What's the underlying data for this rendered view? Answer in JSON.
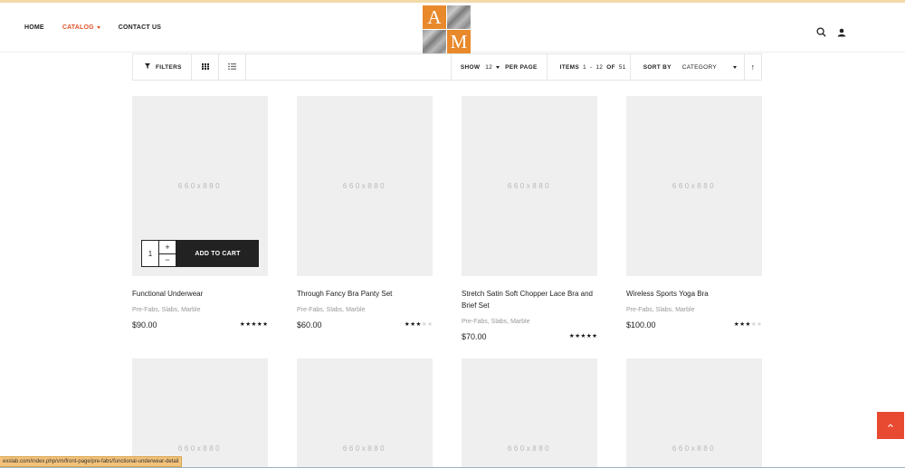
{
  "nav": {
    "home": "HOME",
    "catalog": "CATALOG",
    "contact": "CONTACT US"
  },
  "logo": {
    "letter_a": "A",
    "letter_m": "M"
  },
  "toolbar": {
    "filters_label": "FILTERS",
    "show_label": "SHOW",
    "show_value": "12",
    "per_page_label": "PER PAGE",
    "items_label": "ITEMS",
    "items_from": "1",
    "items_dash": "-",
    "items_to": "12",
    "of_label": "OF",
    "items_total": "51",
    "sort_label": "SORT BY",
    "sort_value": "CATEGORY",
    "sort_dir_icon": "↑"
  },
  "placeholder_text": "660x880",
  "cart": {
    "qty": "1",
    "plus": "+",
    "minus": "−",
    "add_label": "ADD TO CART"
  },
  "products": [
    {
      "name": "Functional Underwear",
      "category": "Pre-Fabs, Slabs, Marble",
      "price": "$90.00",
      "rating": 5
    },
    {
      "name": "Through Fancy Bra Panty Set",
      "category": "Pre-Fabs, Slabs, Marble",
      "price": "$60.00",
      "rating": 3
    },
    {
      "name": "Stretch Satin Soft Chopper Lace Bra and Brief Set",
      "category": "Pre-Fabs, Slabs, Marble",
      "price": "$70.00",
      "rating": 5
    },
    {
      "name": "Wireless Sports Yoga Bra",
      "category": "Pre-Fabs, Slabs, Marble",
      "price": "$100.00",
      "rating": 3
    }
  ],
  "status_url": "exslab.com/index.php/vm/front-page/pre-fabs/functional-underwear-detail",
  "colors": {
    "accent": "#e0522b",
    "logo_orange": "#e8892b",
    "scroll_button": "#e84a31"
  }
}
